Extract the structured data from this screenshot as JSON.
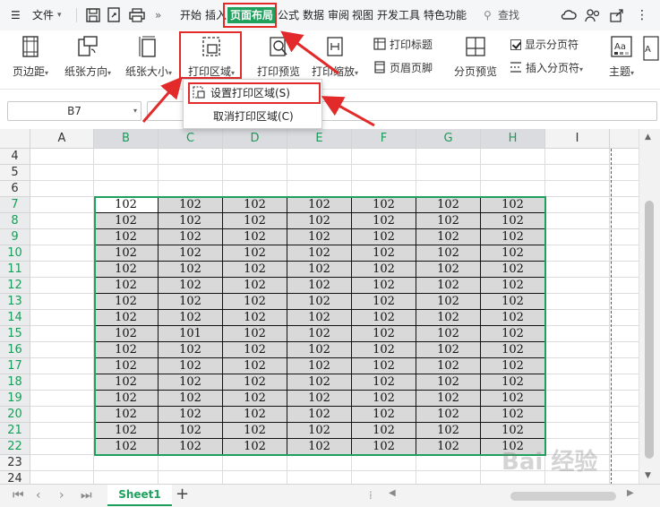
{
  "menu": {
    "file_label": "文件",
    "tabs": [
      {
        "label": "开始",
        "active": false
      },
      {
        "label": "插入",
        "active": false
      },
      {
        "label": "页面布局",
        "active": true
      },
      {
        "label": "公式",
        "active": false
      },
      {
        "label": "数据",
        "active": false
      },
      {
        "label": "审阅",
        "active": false
      },
      {
        "label": "视图",
        "active": false
      },
      {
        "label": "开发工具",
        "active": false
      },
      {
        "label": "特色功能",
        "active": false
      }
    ],
    "search_label": "查找",
    "more_glyph": "»"
  },
  "ribbon": {
    "margins": "页边距",
    "orientation": "纸张方向",
    "size": "纸张大小",
    "print_area": "打印区域",
    "print_preview": "打印预览",
    "print_scale": "打印缩放",
    "print_titles": "打印标题",
    "header_footer": "页眉页脚",
    "page_break_preview": "分页预览",
    "show_page_breaks": "显示分页符",
    "insert_page_break": "插入分页符",
    "theme": "主题"
  },
  "dropdown": {
    "items": [
      "设置打印区域(S)",
      "取消打印区域(C)"
    ]
  },
  "formula": {
    "namebox": "B7"
  },
  "grid": {
    "columns": [
      "A",
      "B",
      "C",
      "D",
      "E",
      "F",
      "G",
      "H",
      "I"
    ],
    "rows": [
      "4",
      "5",
      "6",
      "7",
      "8",
      "9",
      "10",
      "11",
      "12",
      "13",
      "14",
      "15",
      "16",
      "17",
      "18",
      "19",
      "20",
      "21",
      "22",
      "23",
      "24"
    ],
    "cell_values": [
      [
        "102",
        "102",
        "102",
        "102",
        "102",
        "102",
        "102"
      ],
      [
        "102",
        "102",
        "102",
        "102",
        "102",
        "102",
        "102"
      ],
      [
        "102",
        "102",
        "102",
        "102",
        "102",
        "102",
        "102"
      ],
      [
        "102",
        "102",
        "102",
        "102",
        "102",
        "102",
        "102"
      ],
      [
        "102",
        "102",
        "102",
        "102",
        "102",
        "102",
        "102"
      ],
      [
        "102",
        "102",
        "102",
        "102",
        "102",
        "102",
        "102"
      ],
      [
        "102",
        "102",
        "102",
        "102",
        "102",
        "102",
        "102"
      ],
      [
        "102",
        "102",
        "102",
        "102",
        "102",
        "102",
        "102"
      ],
      [
        "102",
        "101",
        "102",
        "102",
        "102",
        "102",
        "102"
      ],
      [
        "102",
        "102",
        "102",
        "102",
        "102",
        "102",
        "102"
      ],
      [
        "102",
        "102",
        "102",
        "102",
        "102",
        "102",
        "102"
      ],
      [
        "102",
        "102",
        "102",
        "102",
        "102",
        "102",
        "102"
      ],
      [
        "102",
        "102",
        "102",
        "102",
        "102",
        "102",
        "102"
      ],
      [
        "102",
        "102",
        "102",
        "102",
        "102",
        "102",
        "102"
      ],
      [
        "102",
        "102",
        "102",
        "102",
        "102",
        "102",
        "102"
      ],
      [
        "102",
        "102",
        "102",
        "102",
        "102",
        "102",
        "102"
      ]
    ]
  },
  "sheets": {
    "active": "Sheet1",
    "add_glyph": "+"
  },
  "watermark": "Bai 经验",
  "colors": {
    "accent": "#1fa05d",
    "highlight": "#e22a2a"
  }
}
